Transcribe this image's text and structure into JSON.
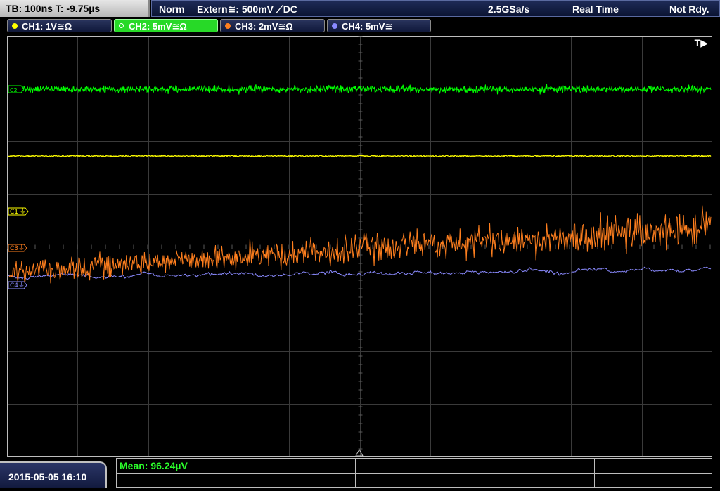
{
  "topbar": {
    "timebase": "TB: 100ns   T: -9.75µs",
    "mode": "Norm",
    "trigger": "Extern≅: 500mV ⟋DC",
    "sample_rate": "2.5GSa/s",
    "acq_mode": "Real Time",
    "state": "Not Rdy."
  },
  "channels": [
    {
      "label": "CH1: 1V≅Ω",
      "color": "#ffff00"
    },
    {
      "label": "CH2: 5mV≅Ω",
      "color": "#00ff00",
      "selected": true
    },
    {
      "label": "CH3: 2mV≅Ω",
      "color": "#ff7f1e"
    },
    {
      "label": "CH4: 5mV≅",
      "color": "#8a8aff"
    }
  ],
  "screen": {
    "trigger_flag": "T▶",
    "markers": {
      "c1": "C1",
      "c2": "C2",
      "c3": "C3",
      "c4": "C4"
    }
  },
  "bottom": {
    "datetime": "2015-05-05 16:10",
    "measurement": "Mean: 96.24µV"
  },
  "icons": {
    "trigger_position": "trigger-triangle-icon",
    "ground_marker": "ground-symbol-icon"
  }
}
